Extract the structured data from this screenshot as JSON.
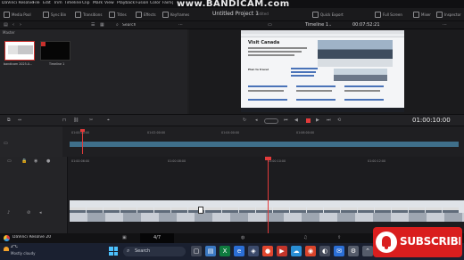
{
  "app": {
    "name": "DaVinci Resolve",
    "menu": [
      "DaVinci Resolve",
      "File",
      "Edit",
      "Trim",
      "Timeline",
      "Clip",
      "Mark",
      "View",
      "Playback",
      "Fusion",
      "Color",
      "Fairlight"
    ],
    "watermark": "www.BANDICAM.com"
  },
  "toolbar": {
    "media_pool": "Media Pool",
    "sync_bin": "Sync Bin",
    "transitions": "Transitions",
    "titles": "Titles",
    "effects": "Effects",
    "keyframes": "Keyframes",
    "project_title": "Untitled Project 1",
    "project_status": "Edited",
    "quick_export": "Quick Export",
    "full_screen": "Full Screen",
    "mixer": "Mixer",
    "inspector": "Inspector"
  },
  "subbar": {
    "search": "Search",
    "timeline_name": "Timeline 1",
    "timecode": "00:07:52:21"
  },
  "media_pool": {
    "bin": "Master",
    "clips": [
      {
        "name": "bandicam 2025-0..."
      },
      {
        "name": "Timeline 1"
      }
    ]
  },
  "viewer": {
    "site_heading": "Visit Canada",
    "section_heading": "Plan to travel"
  },
  "transport": {
    "timecode": "01:00:10:00"
  },
  "timeline": {
    "upper_ticks": [
      "01:00:00:00",
      "01:02:00:00",
      "01:04:00:00",
      "01:06:00:00"
    ],
    "lower_ticks": [
      "01:00:06:00",
      "01:00:08:00",
      "01:00:10:00",
      "01:00:12:00"
    ]
  },
  "pagebar": {
    "logo_text": "DaVinci Resolve 20",
    "counter": "4/7"
  },
  "taskbar": {
    "temperature": "2°C",
    "weather": "Mostly cloudy",
    "search": "Search"
  },
  "overlay": {
    "subscribe": "SUBSCRIBE"
  },
  "colors": {
    "accent_red": "#e23b3b",
    "clip_blue": "#3f6f8a",
    "timecode_orange": "#f2a12b",
    "subscribe_red": "#d91e1e"
  }
}
